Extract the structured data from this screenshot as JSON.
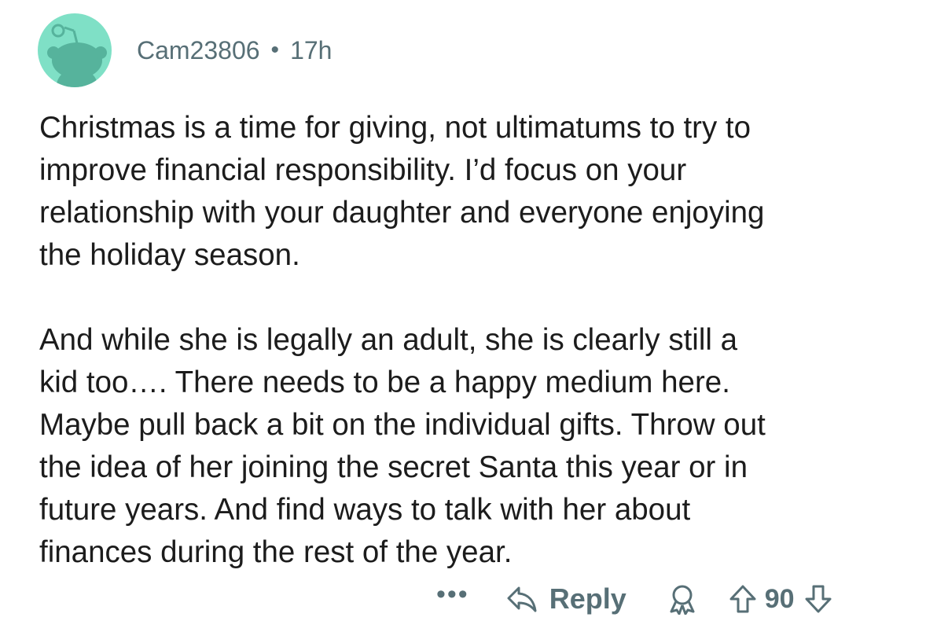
{
  "comment": {
    "username": "Cam23806",
    "separator": "•",
    "age": "17h",
    "paragraphs": [
      "Christmas is a time for giving, not ultimatums to try to\nimprove financial responsibility. I’d focus on your\nrelationship with your daughter and everyone enjoying\nthe holiday season.",
      "And while she is legally an adult, she is clearly still a\nkid too…. There needs to be a happy medium here.\nMaybe pull back a bit on the individual gifts. Throw out\nthe idea of her joining the secret Santa this year or in\nfuture years. And find ways to talk with her about\nfinances during the rest of the year."
    ]
  },
  "actions": {
    "more_label": "•••",
    "reply_label": "Reply",
    "score": "90",
    "icons": {
      "more": "more-options-icon",
      "reply": "reply-arrow-icon",
      "award": "award-icon",
      "upvote": "upvote-arrow-icon",
      "downvote": "downvote-arrow-icon"
    }
  },
  "colors": {
    "avatar_bg": "#7fe0c6",
    "text": "#1c1c1c",
    "meta": "#576f76"
  }
}
